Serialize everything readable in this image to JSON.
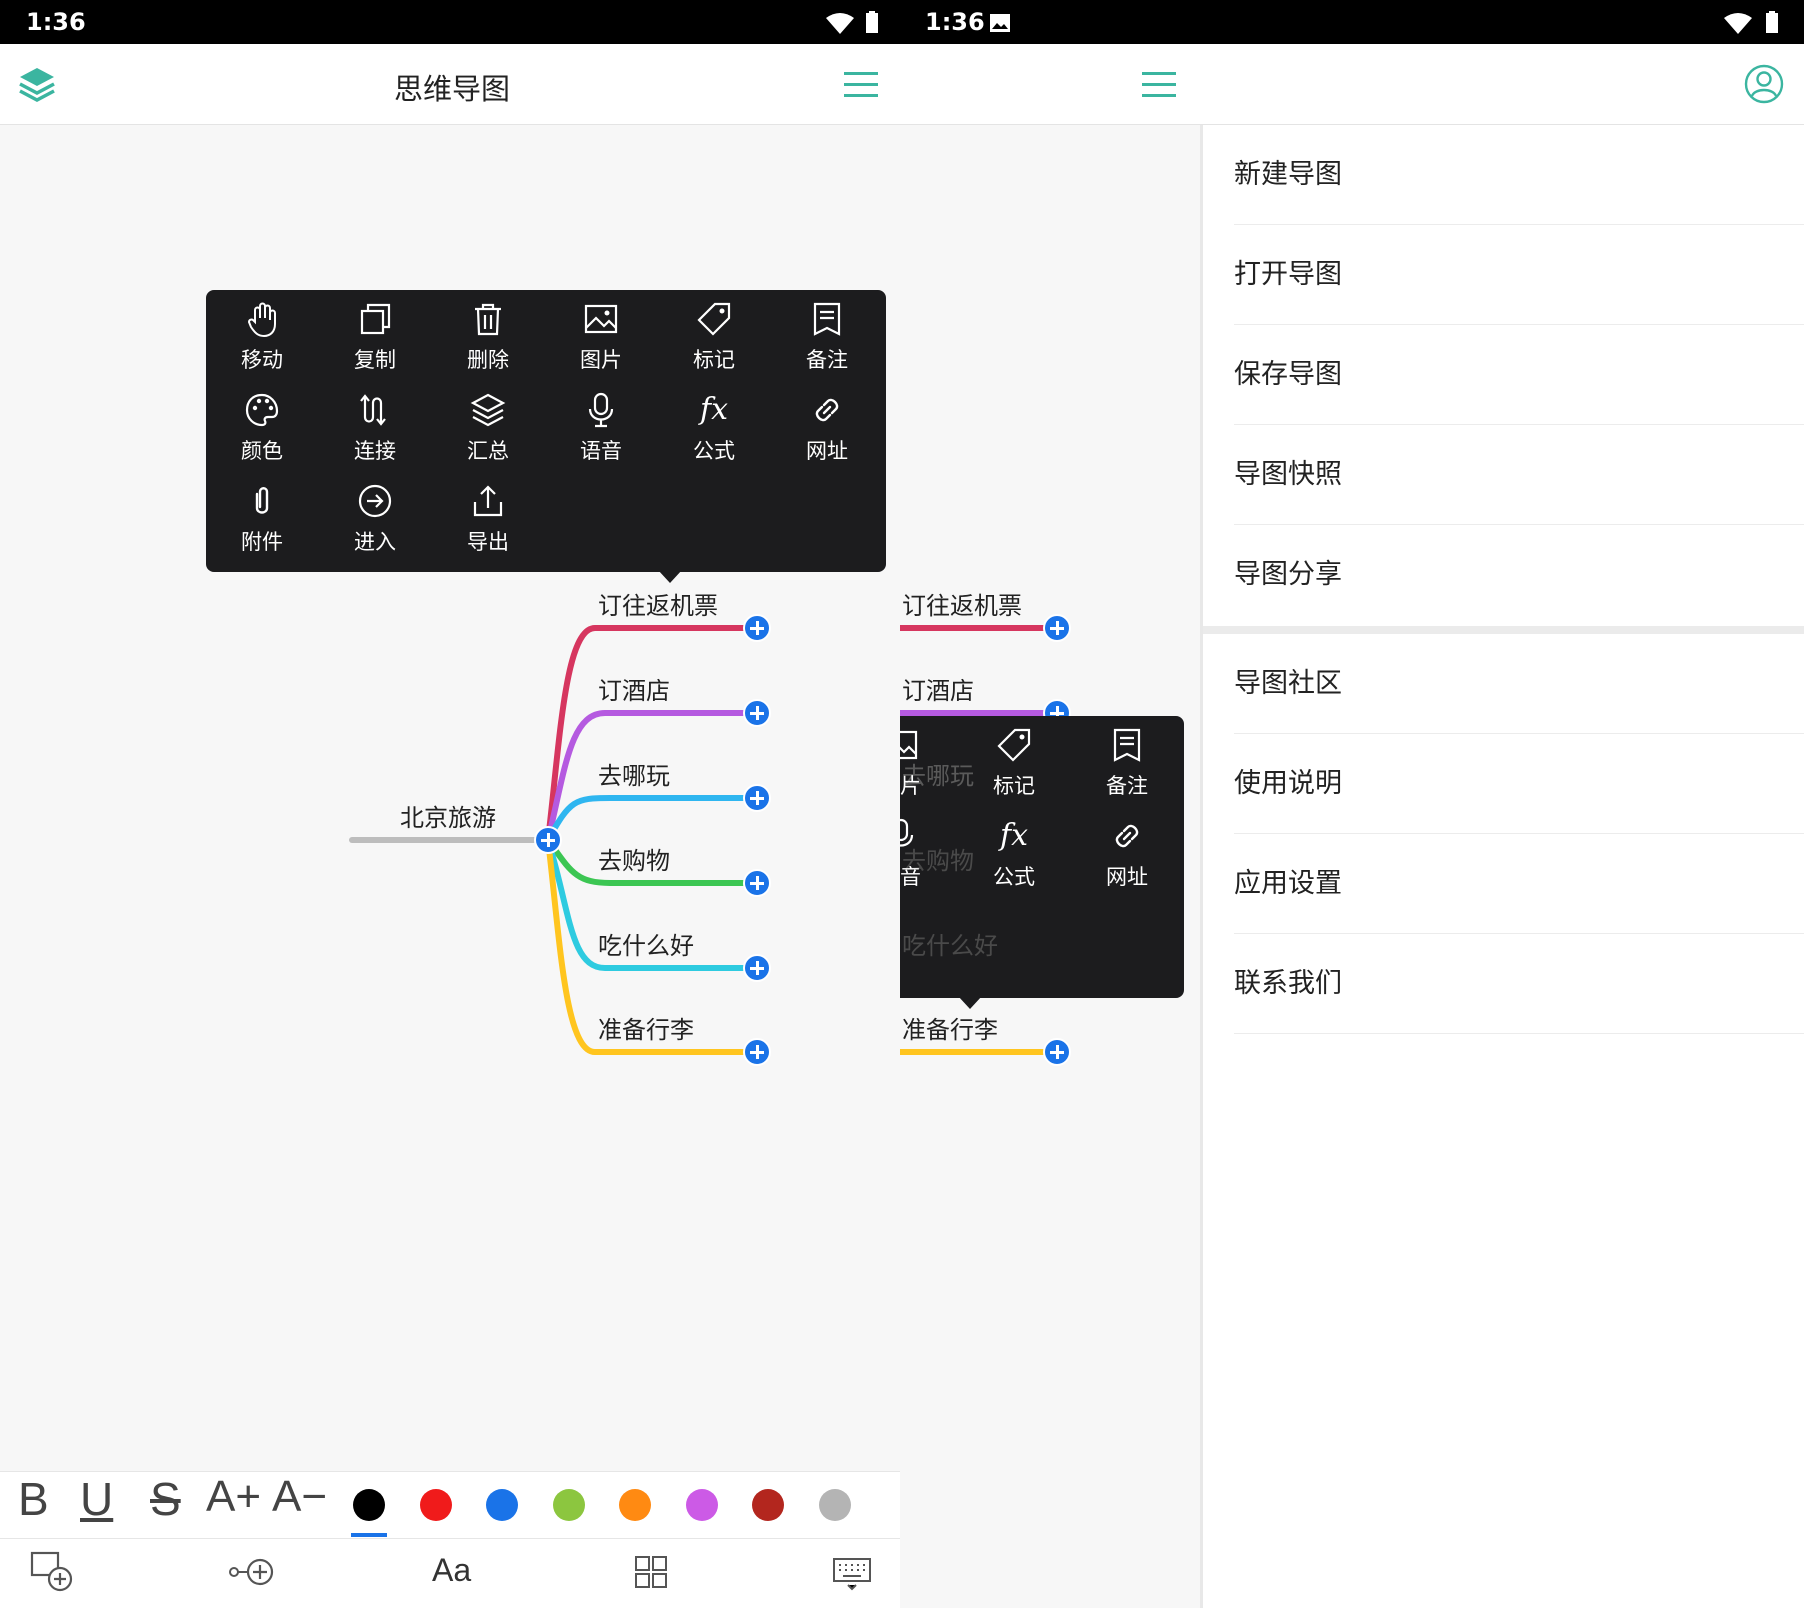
{
  "left": {
    "status_time": "1:36",
    "title": "思维导图",
    "root_label": "北京旅游",
    "branches": [
      {
        "label": "订往返机票",
        "color": "#d6365f"
      },
      {
        "label": "订酒店",
        "color": "#b55ae0"
      },
      {
        "label": "去哪玩",
        "color": "#2fb6f0"
      },
      {
        "label": "去购物",
        "color": "#3cc653"
      },
      {
        "label": "吃什么好",
        "color": "#2ecbe0"
      },
      {
        "label": "准备行李",
        "color": "#ffc51f"
      }
    ],
    "popup_items": [
      "移动",
      "复制",
      "删除",
      "图片",
      "标记",
      "备注",
      "颜色",
      "连接",
      "汇总",
      "语音",
      "公式",
      "网址",
      "附件",
      "进入",
      "导出"
    ],
    "format_buttons": {
      "bold": "B",
      "underline": "U",
      "strike": "S",
      "size_up": "A+",
      "size_down": "A−"
    },
    "swatches": [
      "#000000",
      "#f01b1b",
      "#1a73e8",
      "#8cc63f",
      "#ff8a12",
      "#cc5ae6",
      "#b3261e",
      "#b4b4b4"
    ],
    "bottom_tools": {
      "text": "Aa"
    }
  },
  "right": {
    "status_time": "1:36",
    "branch_labels": [
      "订往返机票",
      "订酒店",
      "去哪玩",
      "去购物",
      "吃什么好",
      "准备行李"
    ],
    "popup_partial": [
      "片",
      "标记",
      "备注",
      "音",
      "公式",
      "网址"
    ],
    "menu_group1": [
      "新建导图",
      "打开导图",
      "保存导图",
      "导图快照",
      "导图分享"
    ],
    "menu_group2": [
      "导图社区",
      "使用说明",
      "应用设置",
      "联系我们"
    ]
  }
}
